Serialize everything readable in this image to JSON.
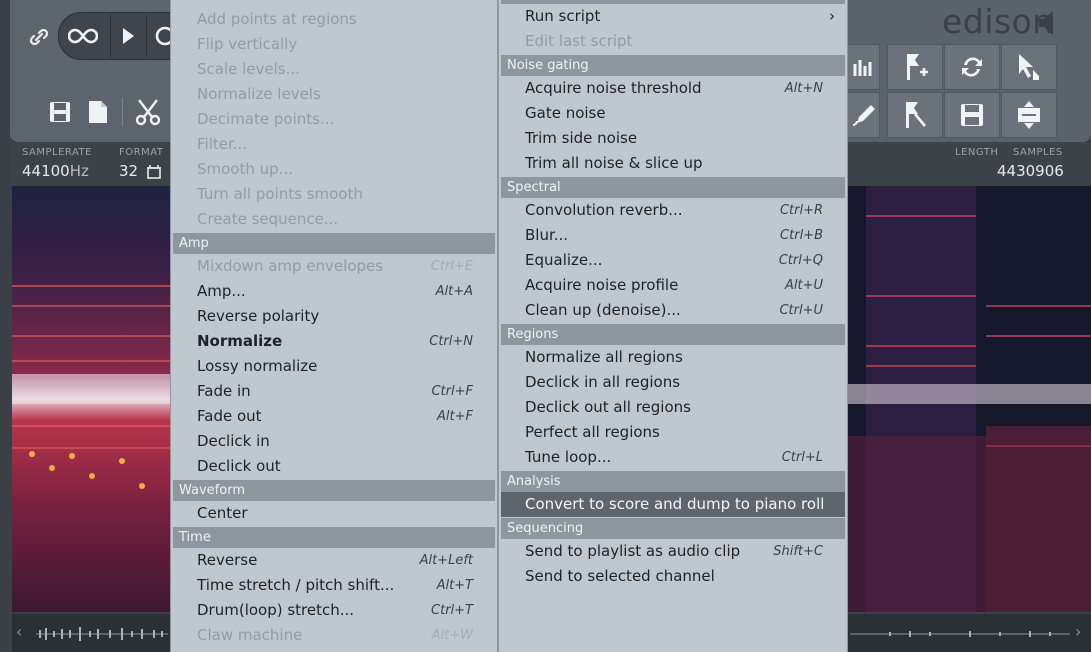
{
  "app": {
    "logo_text": "edison",
    "samplerate_label": "SAMPLERATE",
    "samplerate_value": "44100",
    "samplerate_unit": "Hz",
    "format_label": "FORMAT",
    "format_value": "32",
    "length_label": "LENGTH",
    "samples_label": "SAMPLES",
    "samples_value": "4430906"
  },
  "menu_left": {
    "items": [
      {
        "label": "Add points at regions",
        "shortcut": "",
        "disabled": true
      },
      {
        "label": "Flip vertically",
        "shortcut": "",
        "disabled": true
      },
      {
        "label": "Scale levels...",
        "shortcut": "",
        "disabled": true
      },
      {
        "label": "Normalize levels",
        "shortcut": "",
        "disabled": true
      },
      {
        "label": "Decimate points...",
        "shortcut": "",
        "disabled": true
      },
      {
        "label": "Filter...",
        "shortcut": "",
        "disabled": true
      },
      {
        "label": "Smooth up...",
        "shortcut": "",
        "disabled": true
      },
      {
        "label": "Turn all points smooth",
        "shortcut": "",
        "disabled": true
      },
      {
        "label": "Create sequence...",
        "shortcut": "",
        "disabled": true
      }
    ],
    "amp_header": "Amp",
    "amp_items": [
      {
        "label": "Mixdown amp envelopes",
        "shortcut": "Ctrl+E",
        "disabled": true
      },
      {
        "label": "Amp...",
        "shortcut": "Alt+A",
        "disabled": false
      },
      {
        "label": "Reverse polarity",
        "shortcut": "",
        "disabled": false
      },
      {
        "label": "Normalize",
        "shortcut": "Ctrl+N",
        "disabled": false,
        "bold": true
      },
      {
        "label": "Lossy normalize",
        "shortcut": "",
        "disabled": false
      },
      {
        "label": "Fade in",
        "shortcut": "Ctrl+F",
        "disabled": false
      },
      {
        "label": "Fade out",
        "shortcut": "Alt+F",
        "disabled": false
      },
      {
        "label": "Declick in",
        "shortcut": "",
        "disabled": false
      },
      {
        "label": "Declick out",
        "shortcut": "",
        "disabled": false
      }
    ],
    "waveform_header": "Waveform",
    "waveform_items": [
      {
        "label": "Center",
        "shortcut": "",
        "disabled": false
      }
    ],
    "time_header": "Time",
    "time_items": [
      {
        "label": "Reverse",
        "shortcut": "Alt+Left",
        "disabled": false
      },
      {
        "label": "Time stretch / pitch shift...",
        "shortcut": "Alt+T",
        "disabled": false
      },
      {
        "label": "Drum(loop) stretch...",
        "shortcut": "Ctrl+T",
        "disabled": false
      },
      {
        "label": "Claw machine",
        "shortcut": "Alt+W",
        "disabled": true
      }
    ]
  },
  "menu_right": {
    "top_items": [
      {
        "label": "Run script",
        "shortcut": "",
        "disabled": false,
        "submenu": true,
        "submenu_arrow": "›"
      },
      {
        "label": "Edit last script",
        "shortcut": "",
        "disabled": true
      }
    ],
    "noise_header": "Noise gating",
    "noise_items": [
      {
        "label": "Acquire noise threshold",
        "shortcut": "Alt+N",
        "disabled": false
      },
      {
        "label": "Gate noise",
        "shortcut": "",
        "disabled": false
      },
      {
        "label": "Trim side noise",
        "shortcut": "",
        "disabled": false
      },
      {
        "label": "Trim all noise & slice up",
        "shortcut": "",
        "disabled": false
      }
    ],
    "spectral_header": "Spectral",
    "spectral_items": [
      {
        "label": "Convolution reverb...",
        "shortcut": "Ctrl+R",
        "disabled": false
      },
      {
        "label": "Blur...",
        "shortcut": "Ctrl+B",
        "disabled": false
      },
      {
        "label": "Equalize...",
        "shortcut": "Ctrl+Q",
        "disabled": false
      },
      {
        "label": "Acquire noise profile",
        "shortcut": "Alt+U",
        "disabled": false
      },
      {
        "label": "Clean up (denoise)...",
        "shortcut": "Ctrl+U",
        "disabled": false
      }
    ],
    "regions_header": "Regions",
    "regions_items": [
      {
        "label": "Normalize all regions",
        "shortcut": "",
        "disabled": false
      },
      {
        "label": "Declick in all regions",
        "shortcut": "",
        "disabled": false
      },
      {
        "label": "Declick out all regions",
        "shortcut": "",
        "disabled": false
      },
      {
        "label": "Perfect all regions",
        "shortcut": "",
        "disabled": false
      },
      {
        "label": "Tune loop...",
        "shortcut": "Ctrl+L",
        "disabled": false
      }
    ],
    "analysis_header": "Analysis",
    "analysis_items": [
      {
        "label": "Convert to score and dump to piano roll",
        "shortcut": "",
        "disabled": false,
        "highlight": true
      }
    ],
    "sequencing_header": "Sequencing",
    "sequencing_items": [
      {
        "label": "Send to playlist as audio clip",
        "shortcut": "Shift+C",
        "disabled": false
      },
      {
        "label": "Send to selected channel",
        "shortcut": "",
        "disabled": false
      }
    ]
  },
  "colors": {
    "menu_bg": "#c0c8cf",
    "header_bg": "#8e979f",
    "highlight_bg": "#5d666e",
    "toolbar_bg": "#5a636b"
  }
}
